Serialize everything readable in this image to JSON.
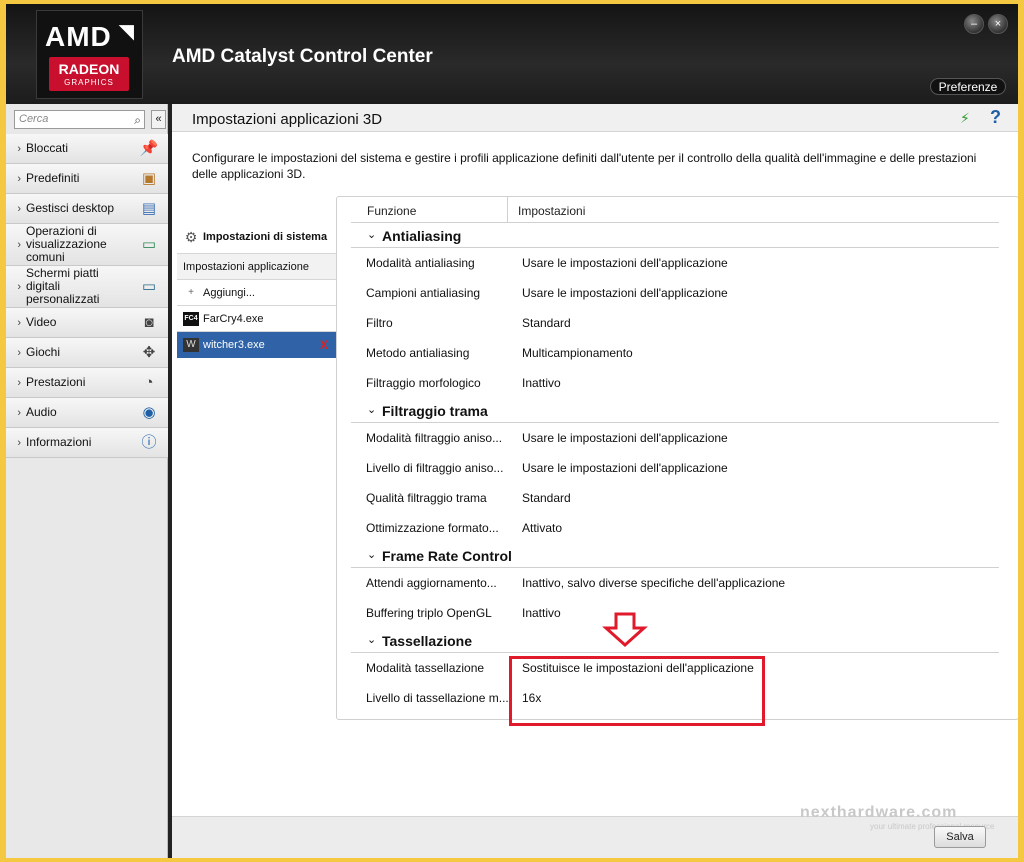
{
  "window": {
    "title": "AMD Catalyst Control Center",
    "logo": {
      "brand": "AMD",
      "product": "RADEON",
      "sub": "GRAPHICS"
    },
    "preferences_label": "Preferenze",
    "minimize_glyph": "–",
    "close_glyph": "×"
  },
  "sidebar": {
    "search_placeholder": "Cerca",
    "collapse_glyph": "«",
    "items": [
      {
        "label": "Bloccati",
        "icon": "pin-icon"
      },
      {
        "label": "Predefiniti",
        "icon": "preset-icon"
      },
      {
        "label": "Gestisci desktop",
        "icon": "desktop-icon"
      },
      {
        "label": "Operazioni di visualizzazione comuni",
        "icon": "display-icon"
      },
      {
        "label": "Schermi piatti digitali personalizzati",
        "icon": "monitor-icon"
      },
      {
        "label": "Video",
        "icon": "camera-icon"
      },
      {
        "label": "Giochi",
        "icon": "gamepad-icon"
      },
      {
        "label": "Prestazioni",
        "icon": "gauge-icon"
      },
      {
        "label": "Audio",
        "icon": "speaker-icon"
      },
      {
        "label": "Informazioni",
        "icon": "info-icon"
      }
    ]
  },
  "main": {
    "title": "Impostazioni applicazioni 3D",
    "description": "Configurare le impostazioni del sistema e gestire i profili applicazione definiti dall'utente per il controllo della qualità dell'immagine e delle prestazioni delle applicazioni 3D.",
    "profiles": {
      "system": "Impostazioni di sistema",
      "app_header": "Impostazioni applicazione",
      "add": "Aggiungi...",
      "apps": [
        {
          "name": "FarCry4.exe",
          "icon_text": "FC4",
          "selected": false
        },
        {
          "name": "witcher3.exe",
          "icon_text": "W",
          "selected": true
        }
      ],
      "delete_glyph": "X"
    },
    "columns": {
      "function": "Funzione",
      "settings": "Impostazioni"
    },
    "sections": [
      {
        "title": "Antialiasing",
        "rows": [
          {
            "f": "Modalità antialiasing",
            "v": "Usare le impostazioni dell'applicazione"
          },
          {
            "f": "Campioni antialiasing",
            "v": "Usare le impostazioni dell'applicazione"
          },
          {
            "f": "Filtro",
            "v": "Standard"
          },
          {
            "f": "Metodo antialiasing",
            "v": "Multicampionamento"
          },
          {
            "f": "Filtraggio morfologico",
            "v": "Inattivo"
          }
        ]
      },
      {
        "title": "Filtraggio trama",
        "rows": [
          {
            "f": "Modalità filtraggio aniso...",
            "v": "Usare le impostazioni dell'applicazione"
          },
          {
            "f": "Livello di filtraggio aniso...",
            "v": "Usare le impostazioni dell'applicazione"
          },
          {
            "f": "Qualità filtraggio trama",
            "v": "Standard"
          },
          {
            "f": "Ottimizzazione formato...",
            "v": "Attivato"
          }
        ]
      },
      {
        "title": "Frame Rate Control",
        "rows": [
          {
            "f": "Attendi aggiornamento...",
            "v": "Inattivo, salvo diverse specifiche dell'applicazione"
          },
          {
            "f": "Buffering triplo OpenGL",
            "v": "Inattivo"
          }
        ]
      },
      {
        "title": "Tassellazione",
        "rows": [
          {
            "f": "Modalità tassellazione",
            "v": "Sostituisce le impostazioni dell'applicazione"
          },
          {
            "f": "Livello di tassellazione m...",
            "v": "16x"
          }
        ]
      }
    ],
    "save_label": "Salva",
    "highlight_color": "#e0192b"
  },
  "watermark": {
    "text": "nexthardware.com",
    "sub": "your ultimate professional resource"
  }
}
